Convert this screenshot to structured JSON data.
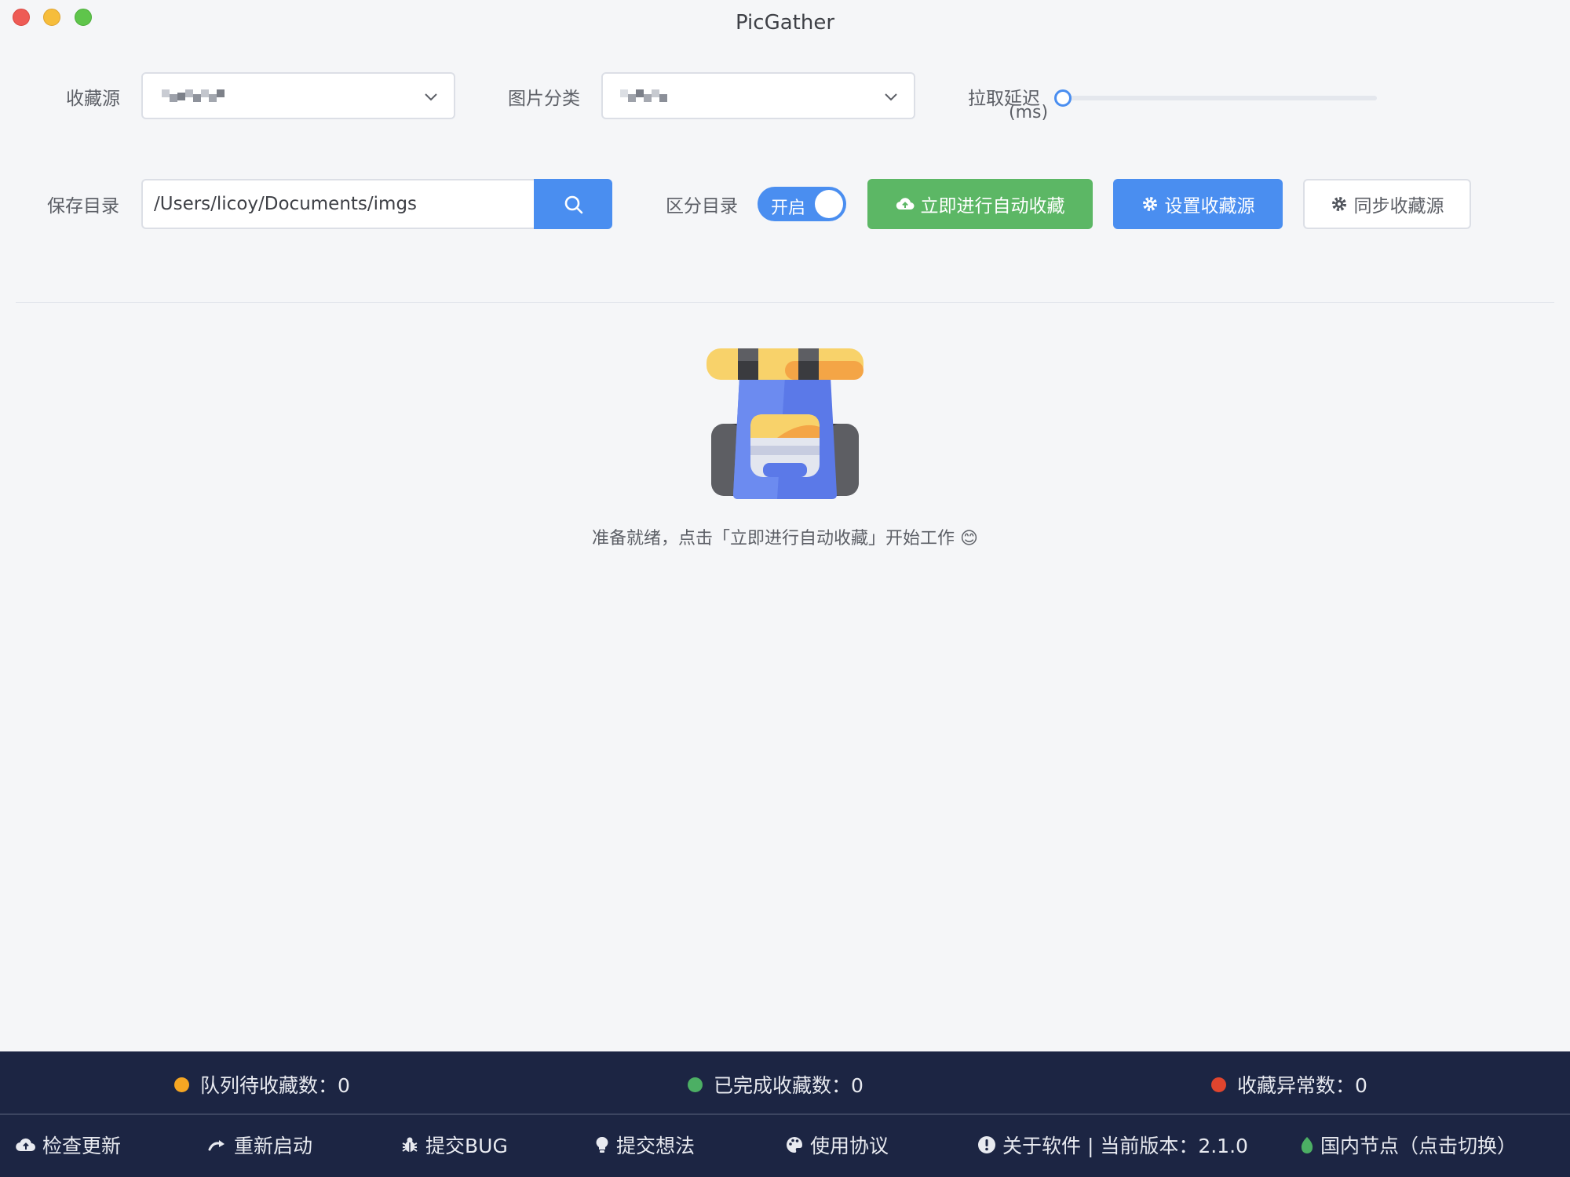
{
  "window": {
    "title": "PicGather"
  },
  "controls": {
    "source_label": "收藏源",
    "category_label": "图片分类",
    "delay_label_line1": "拉取延迟",
    "delay_label_line2": "(ms)",
    "delay_value": 0,
    "save_dir_label": "保存目录",
    "save_dir_value": "/Users/licoy/Documents/imgs",
    "separate_dir_label": "区分目录",
    "separate_dir_toggle_text": "开启",
    "separate_dir_on": true
  },
  "buttons": {
    "auto_collect": "立即进行自动收藏",
    "set_source": "设置收藏源",
    "sync_source": "同步收藏源"
  },
  "empty_state": {
    "message": "准备就绪，点击「立即进行自动收藏」开始工作 😊"
  },
  "stats": {
    "queue": "队列待收藏数：0",
    "done": "已完成收藏数：0",
    "error": "收藏异常数：0",
    "colors": {
      "queue": "#f5a623",
      "done": "#4caf64",
      "error": "#e0452e"
    }
  },
  "footer": {
    "check_update": "检查更新",
    "restart": "重新启动",
    "submit_bug": "提交BUG",
    "submit_idea": "提交想法",
    "agreement": "使用协议",
    "about": "关于软件 | 当前版本：2.1.0",
    "node": "国内节点（点击切换）"
  },
  "colors": {
    "primary": "#4a8ef0",
    "success": "#5cb765",
    "bar": "#1c2543"
  }
}
